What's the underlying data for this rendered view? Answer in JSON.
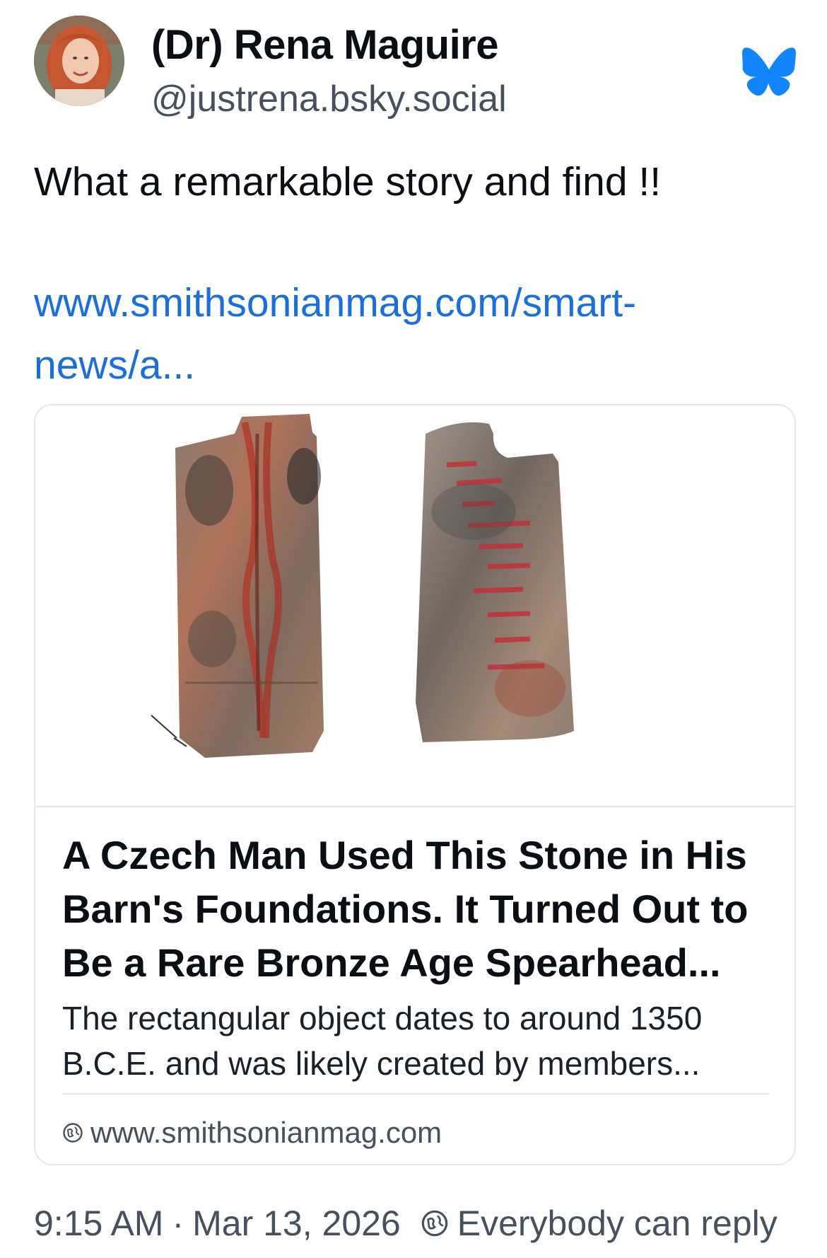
{
  "author": {
    "display_name": "(Dr) Rena Maguire",
    "handle": "@justrena.bsky.social"
  },
  "post": {
    "text": "What a remarkable story and find !!",
    "link_text": "www.smithsonianmag.com/smart-news/a..."
  },
  "card": {
    "title": "A Czech Man Used This Stone in His Barn's Foundations. It Turned Out to Be a Rare Bronze Age Spearhead...",
    "description": "The rectangular object dates to around 1350 B.C.E. and was likely created by members...",
    "domain": "www.smithsonianmag.com"
  },
  "footer": {
    "time": "9:15 AM",
    "separator": "·",
    "date": "Mar 13, 2026",
    "reply_setting": "Everybody can reply"
  },
  "colors": {
    "link": "#1a6fe0",
    "bluesky": "#1185fe",
    "muted": "#47505c",
    "border": "#e3e8ee"
  },
  "icons": {
    "app": "bluesky-butterfly-icon",
    "domain": "globe-icon",
    "reply": "globe-icon"
  }
}
